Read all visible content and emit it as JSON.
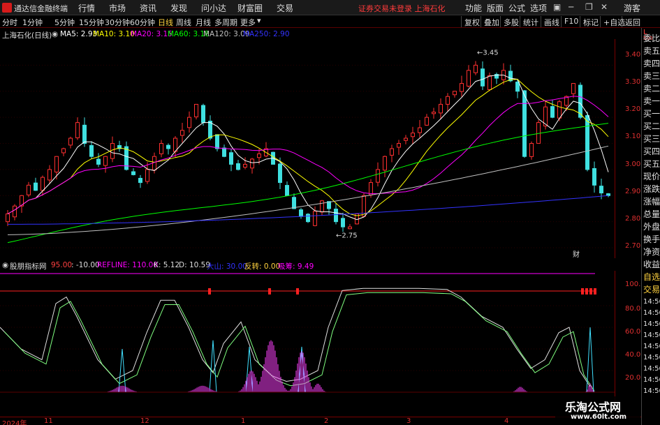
{
  "titlebar": {
    "app_name": "通达信金融终端",
    "menus": [
      "行情",
      "市场",
      "资讯",
      "发现",
      "问小达",
      "财富圈",
      "交易"
    ],
    "status": "证券交易未登录  上海石化",
    "right_menus": [
      "功能",
      "版面",
      "公式",
      "选项"
    ],
    "guest": "游客"
  },
  "toolbar": {
    "periods": [
      "分时",
      "1分钟",
      "5分钟",
      "15分钟",
      "30分钟",
      "60分钟",
      "日线",
      "周线",
      "月线",
      "多周期",
      "更多"
    ],
    "active_period": "日线",
    "buttons": [
      "复权",
      "叠加",
      "多股",
      "统计",
      "画线",
      "F10",
      "标记",
      "+自选",
      "返回"
    ]
  },
  "info": {
    "title": "上海石化(日线)",
    "ma5": "MA5: 2.93",
    "ma10": "MA10: 3.10",
    "ma20": "MA20: 3.15",
    "ma60": "MA60: 3.18",
    "ma120": "MA120: 3.09",
    "ma250": "MA250: 2.90",
    "colors": {
      "ma5": "#ffffff",
      "ma10": "#ffff00",
      "ma20": "#ff00ff",
      "ma60": "#00ff00",
      "ma120": "#c0c0c0",
      "ma250": "#3333ff"
    }
  },
  "price_axis": {
    "labels": [
      "3.40",
      "3.30",
      "3.20",
      "3.10",
      "3.00",
      "2.90",
      "2.80",
      "2.70"
    ],
    "scale_top": "L",
    "scale_sub": "500"
  },
  "annotations": {
    "high": "3.45",
    "low": "2.75",
    "cai": "财"
  },
  "sidepanel": {
    "items": [
      "委比",
      "卖五",
      "卖四",
      "卖三",
      "卖二",
      "卖一",
      "买一",
      "买二",
      "买三",
      "买四",
      "买五",
      "现价",
      "涨跌",
      "涨幅",
      "总量",
      "外盘",
      "换手",
      "净资",
      "收益",
      "自选",
      "交易",
      "14:56",
      "14:56",
      "14:56",
      "14:56",
      "14:56",
      "14:56",
      "14:56",
      "14:56",
      "14:56"
    ]
  },
  "indicator": {
    "name": "股朋指标网",
    "v1": "95.00",
    "v2": ": -10.00",
    "refline": "REFLINE: 110.00",
    "k": "K: 5.12",
    "d": "D: 10.59",
    "dashan": "大山: 30.00",
    "fanzhuan": "反转: 0.00",
    "xichou": "吸筹: 9.49",
    "axis_labels": [
      "100.0",
      "80.00",
      "60.00",
      "40.00",
      "20.00"
    ]
  },
  "dateaxis": {
    "labels": [
      "2024年",
      "11",
      "12",
      "1",
      "2",
      "3",
      "4"
    ]
  },
  "watermark": {
    "line1": "乐淘公式网",
    "line2": "www.60lt.com"
  },
  "chart_data": {
    "type": "candlestick",
    "title": "上海石化(日线)",
    "ylim": [
      2.66,
      3.5
    ],
    "closes": [
      2.83,
      2.86,
      2.9,
      2.94,
      2.92,
      2.97,
      3.0,
      3.05,
      3.08,
      3.12,
      3.18,
      3.1,
      3.05,
      3.02,
      3.05,
      3.1,
      3.08,
      3.0,
      2.98,
      2.95,
      3.0,
      3.05,
      3.1,
      3.08,
      3.12,
      3.15,
      3.2,
      3.25,
      3.18,
      3.12,
      3.08,
      3.05,
      3.02,
      3.0,
      3.02,
      3.04,
      3.06,
      3.08,
      3.02,
      2.95,
      2.9,
      2.85,
      2.82,
      2.8,
      2.84,
      2.88,
      2.85,
      2.8,
      2.78,
      2.78,
      2.83,
      2.9,
      2.95,
      3.0,
      3.05,
      3.08,
      3.1,
      3.12,
      3.14,
      3.16,
      3.2,
      3.22,
      3.25,
      3.28,
      3.3,
      3.33,
      3.38,
      3.4,
      3.32,
      3.36,
      3.35,
      3.38,
      3.34,
      3.3,
      3.05,
      3.1,
      3.18,
      3.24,
      3.2,
      3.26,
      3.28,
      3.33,
      3.2,
      3.0,
      2.94,
      2.91,
      2.9
    ]
  }
}
